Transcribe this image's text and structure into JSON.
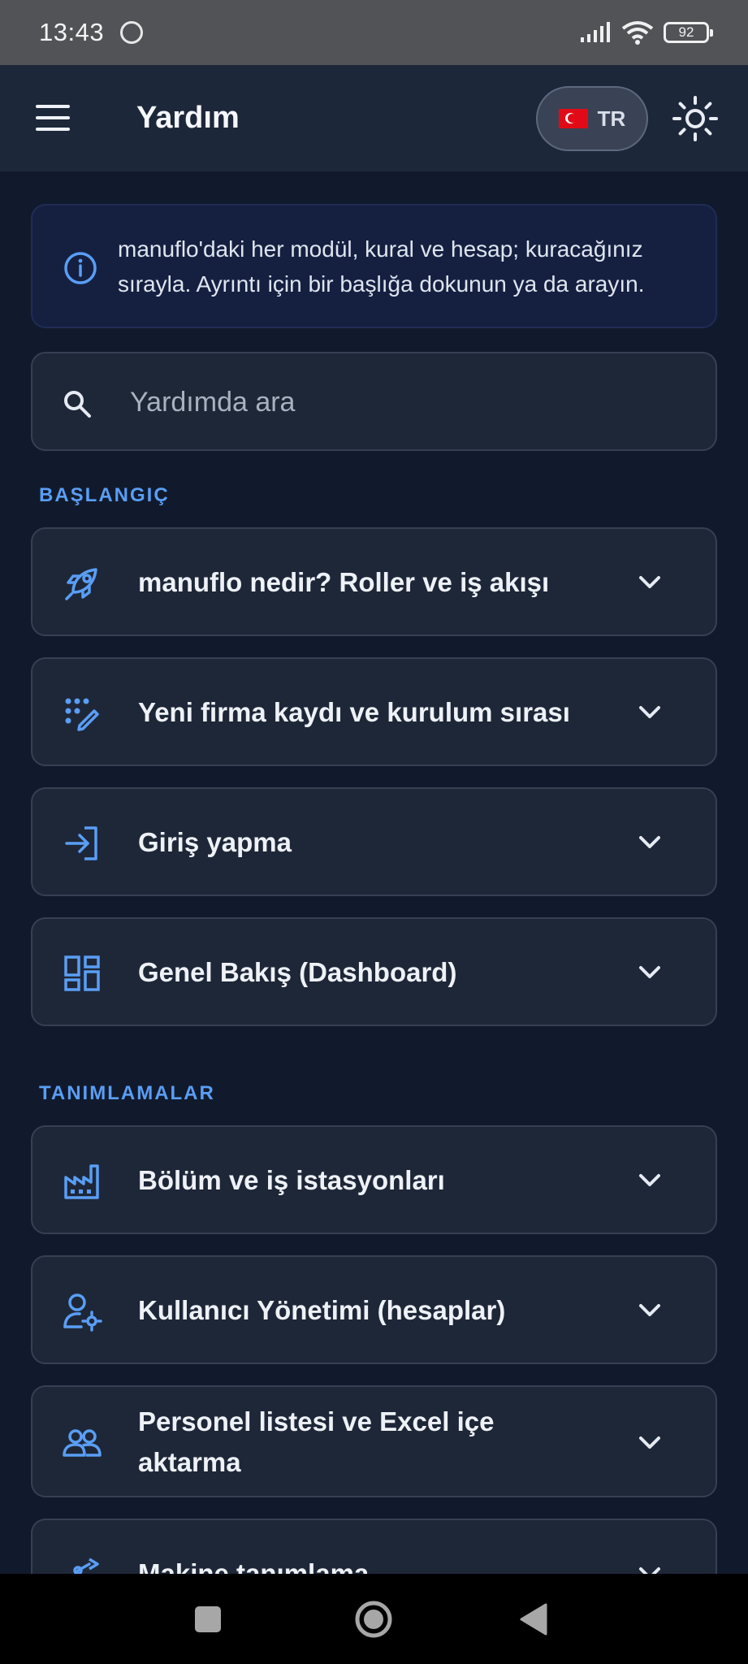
{
  "status_bar": {
    "time": "13:43",
    "battery": "92"
  },
  "app_bar": {
    "title": "Yardım",
    "language": "TR"
  },
  "info": {
    "text": "manuflo'daki her modül, kural ve hesap; kuracağınız sırayla. Ayrıntı için bir başlığa dokunun ya da arayın."
  },
  "search": {
    "placeholder": "Yardımda ara"
  },
  "sections": [
    {
      "title": "BAŞLANGIÇ",
      "items": [
        {
          "label": "manuflo nedir? Roller ve iş akışı",
          "icon": "rocket-icon"
        },
        {
          "label": "Yeni firma kaydı ve kurulum sırası",
          "icon": "dots-edit-icon"
        },
        {
          "label": "Giriş yapma",
          "icon": "login-icon"
        },
        {
          "label": "Genel Bakış (Dashboard)",
          "icon": "dashboard-icon"
        }
      ]
    },
    {
      "title": "TANIMLAMALAR",
      "items": [
        {
          "label": "Bölüm ve iş istasyonları",
          "icon": "factory-icon"
        },
        {
          "label": "Kullanıcı Yönetimi (hesaplar)",
          "icon": "user-gear-icon"
        },
        {
          "label": "Personel listesi ve Excel içe aktarma",
          "icon": "people-icon"
        },
        {
          "label": "Makine tanımlama",
          "icon": "machine-icon"
        }
      ]
    }
  ],
  "colors": {
    "background": "#111a2c",
    "card": "#1e2738",
    "accent": "#5a9ef5",
    "app_bar": "#1d273a"
  }
}
